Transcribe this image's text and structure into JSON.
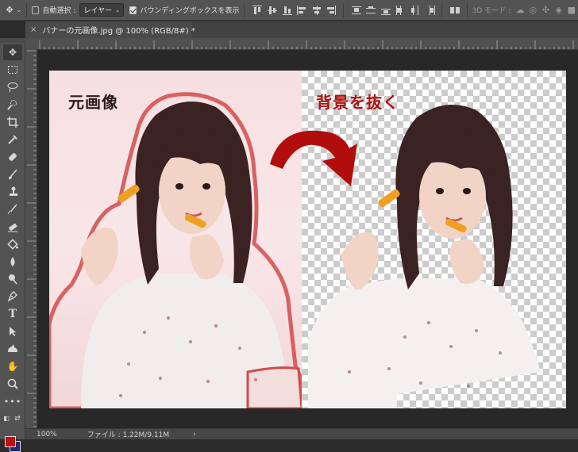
{
  "options_bar": {
    "auto_select_label": "自動選択 :",
    "layer_select_value": "レイヤー",
    "bounding_box_label": "バウンディングボックスを表示",
    "mode_3d_label": "3D モード :"
  },
  "document_tab": {
    "close_glyph": "×",
    "title": "バナーの元画像.jpg @ 100% (RGB/8#) *"
  },
  "image_labels": {
    "original": "元画像",
    "removed_bg": "背景を抜く"
  },
  "colors": {
    "foreground": "#c40d0d",
    "background": "#1b2a7a",
    "arrow": "#b20d0d",
    "caption_original": "#2a1a1a",
    "caption_removed": "#b01010"
  },
  "status_bar": {
    "zoom": "100%",
    "file_info": "ファイル : 1.22M/9.11M",
    "arrow": "›"
  },
  "toolbar_tools": [
    "move-tool",
    "marquee-tool",
    "lasso-tool",
    "quick-select-tool",
    "crop-tool",
    "eyedropper-tool",
    "healing-brush-tool",
    "brush-tool",
    "clone-stamp-tool",
    "history-brush-tool",
    "eraser-tool",
    "paint-bucket-tool",
    "blur-tool",
    "dodge-tool",
    "pen-tool",
    "type-tool",
    "path-select-tool",
    "custom-shape-tool",
    "hand-tool",
    "zoom-tool",
    "more-tools"
  ]
}
